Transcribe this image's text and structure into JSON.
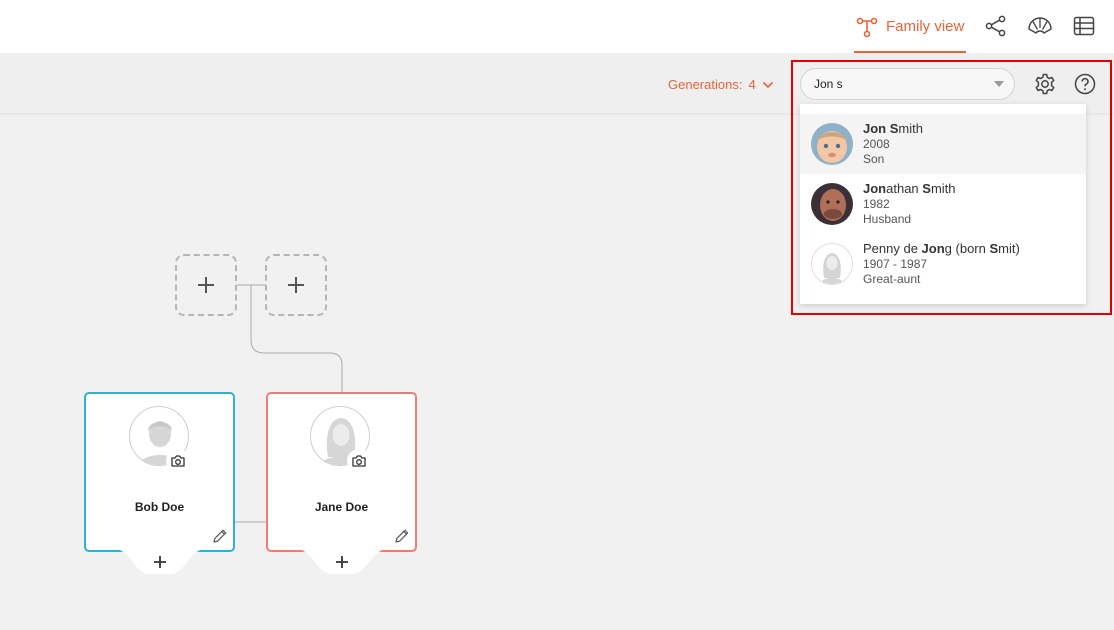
{
  "nav": {
    "family_view_label": "Family view",
    "icons": [
      "family-tree-icon",
      "pedigree-icon",
      "fan-chart-icon",
      "list-table-icon"
    ],
    "accent": "#e8643a"
  },
  "toolbar": {
    "generations_label": "Generations:",
    "generations_value": "4",
    "search_value": "Jon s",
    "icons": [
      "settings-gear-icon",
      "help-icon"
    ]
  },
  "dropdown": {
    "items": [
      {
        "name_bold_1": "Jon",
        "name_rest_1": " ",
        "name_bold_2": "S",
        "name_rest_2": "mith",
        "year": "2008",
        "relation": "Son"
      },
      {
        "name_bold_1": "Jon",
        "name_rest_1": "athan ",
        "name_bold_2": "S",
        "name_rest_2": "mith",
        "year": "1982",
        "relation": "Husband"
      },
      {
        "name_pre": "Penny de ",
        "name_bold_1": "Jon",
        "name_rest_1": "g (born ",
        "name_bold_2": "S",
        "name_rest_2": "mit)",
        "year": "1907 - 1987",
        "relation": "Great-aunt"
      }
    ]
  },
  "tree": {
    "people": [
      {
        "name": "Bob Doe",
        "gender": "male",
        "border": "#2bb3d3"
      },
      {
        "name": "Jane Doe",
        "gender": "female",
        "border": "#f37b76"
      }
    ]
  }
}
